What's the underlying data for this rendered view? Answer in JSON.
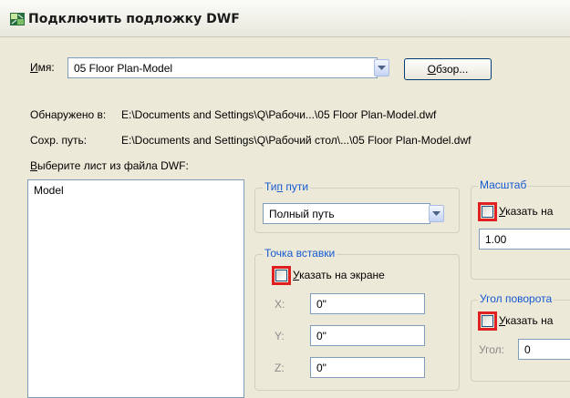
{
  "window": {
    "title": "Подключить подложку DWF",
    "icon": "dwf-app-icon"
  },
  "name_row": {
    "label": "Имя:",
    "value": "05 Floor Plan-Model",
    "browse_label": "Обзор..."
  },
  "found_in": {
    "label": "Обнаружено в:",
    "value": "E:\\Documents and Settings\\Q\\Рабочи...\\05 Floor Plan-Model.dwf"
  },
  "saved_path": {
    "label": "Сохр. путь:",
    "value": "E:\\Documents and Settings\\Q\\Рабочий стол\\...\\05 Floor Plan-Model.dwf"
  },
  "sheet_list": {
    "label": "Выберите лист из файла DWF:",
    "items": [
      "Model"
    ]
  },
  "path_type": {
    "title": "Тип пути",
    "selected": "Полный путь"
  },
  "insertion_point": {
    "title": "Точка вставки",
    "specify_label": "Указать на экране",
    "x_label": "X:",
    "x_value": "0\"",
    "y_label": "Y:",
    "y_value": "0\"",
    "z_label": "Z:",
    "z_value": "0\""
  },
  "scale": {
    "title": "Масштаб",
    "specify_label": "Указать на",
    "value": "1.00"
  },
  "rotation": {
    "title": "Угол поворота",
    "specify_label": "Указать на",
    "angle_label": "Угол:",
    "angle_value": "0"
  },
  "colors": {
    "highlight": "#e02020",
    "group_title": "#1559d3",
    "dialog_bg": "#ece9d8"
  }
}
